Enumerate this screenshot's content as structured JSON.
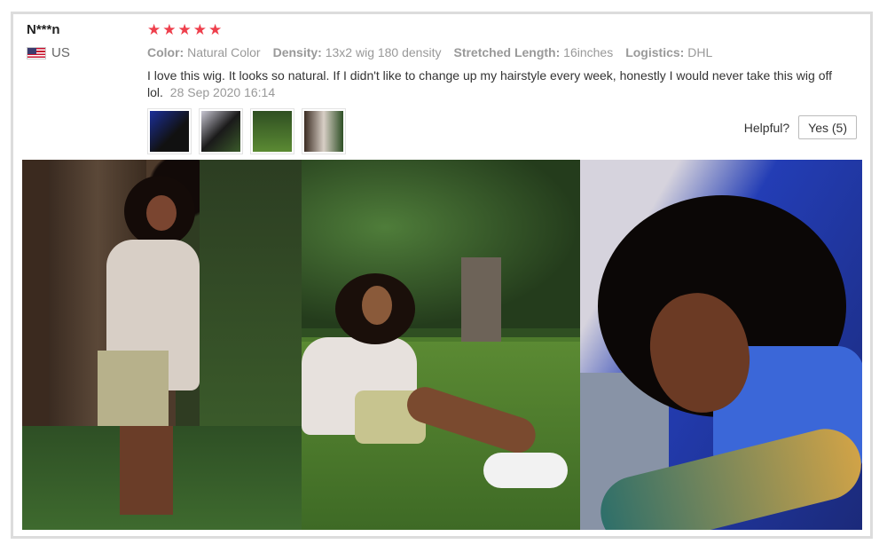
{
  "reviewer": {
    "name": "N***n",
    "country": "US",
    "flag_icon": "us-flag-icon"
  },
  "rating": {
    "stars": 5,
    "max": 5,
    "color": "#ee3f4c"
  },
  "attributes": [
    {
      "label": "Color:",
      "value": "Natural Color"
    },
    {
      "label": "Density:",
      "value": "13x2 wig 180 density"
    },
    {
      "label": "Stretched Length:",
      "value": "16inches"
    },
    {
      "label": "Logistics:",
      "value": "DHL"
    }
  ],
  "review": {
    "text": "I love this wig. It looks so natural. If I didn't like to change up my hairstyle every week, honestly I would never take this wig off lol.",
    "date": "28 Sep 2020 16:14"
  },
  "thumbnails": [
    {
      "name": "photo-thumbnail-1"
    },
    {
      "name": "photo-thumbnail-2"
    },
    {
      "name": "photo-thumbnail-3"
    },
    {
      "name": "photo-thumbnail-4"
    }
  ],
  "helpful": {
    "label": "Helpful?",
    "button": "Yes (5)"
  }
}
